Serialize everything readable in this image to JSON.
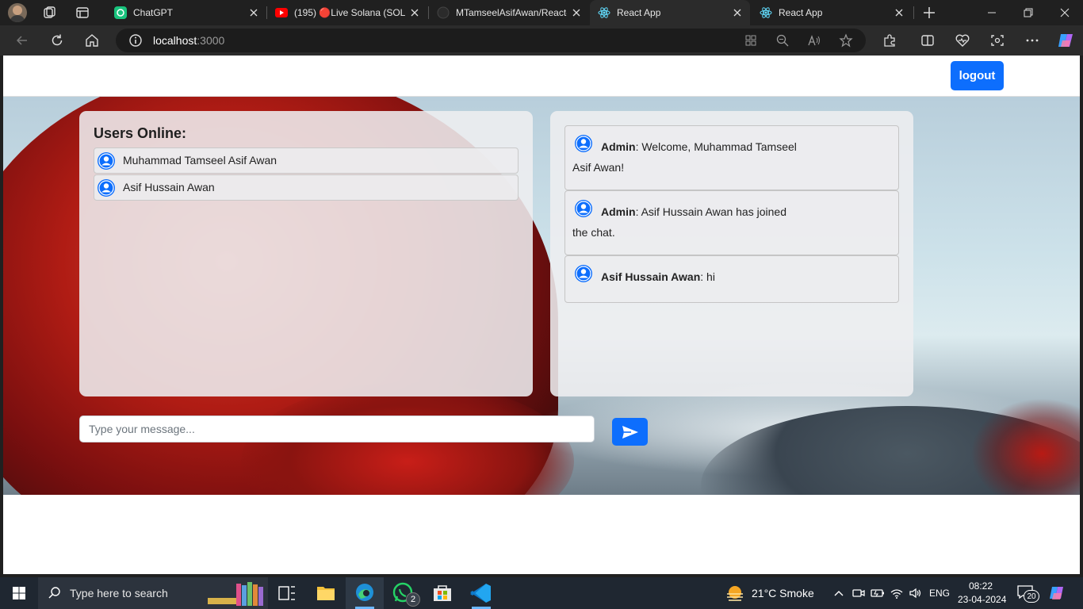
{
  "browser": {
    "tabs": [
      {
        "title": "ChatGPT",
        "icon": "chatgpt-icon",
        "active": false
      },
      {
        "title": "(195) 🔴Live Solana (SOL)",
        "icon": "youtube-icon",
        "active": false
      },
      {
        "title": "MTamseelAsifAwan/React-",
        "icon": "github-icon",
        "active": false
      },
      {
        "title": "React App",
        "icon": "react-icon",
        "active": true
      },
      {
        "title": "React App",
        "icon": "react-icon",
        "active": false
      }
    ],
    "address": {
      "host": "localhost",
      "port": ":3000"
    }
  },
  "app": {
    "logout_label": "logout",
    "users_title": "Users Online:",
    "users": [
      {
        "name": "Muhammad Tamseel Asif Awan"
      },
      {
        "name": "Asif Hussain Awan"
      }
    ],
    "messages": [
      {
        "sender": "Admin",
        "text": ": Welcome, Muhammad Tamseel Asif Awan!"
      },
      {
        "sender": "Admin",
        "text": ": Asif Hussain Awan has joined the chat."
      },
      {
        "sender": "Asif Hussain Awan",
        "text": ": hi"
      }
    ],
    "input_placeholder": "Type your message...",
    "accent_color": "#0d6efd"
  },
  "taskbar": {
    "search_placeholder": "Type here to search",
    "whatsapp_badge": "2",
    "weather": "21°C  Smoke",
    "language": "ENG",
    "time": "08:22",
    "date": "23-04-2024",
    "notifications": "20"
  }
}
